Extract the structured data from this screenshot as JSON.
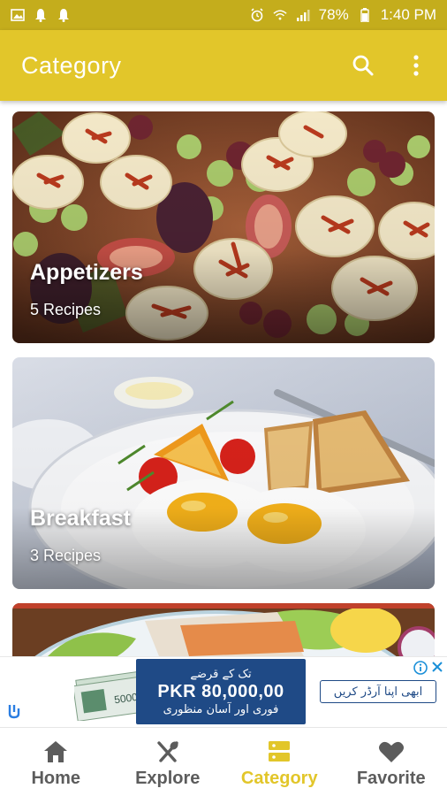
{
  "status_bar": {
    "battery": "78%",
    "time": "1:40 PM",
    "left_icons": [
      "gallery-icon",
      "bell-icon",
      "bell-icon"
    ],
    "right_icons": [
      "alarm-icon",
      "wifi-icon",
      "signal-icon",
      "battery-icon"
    ]
  },
  "app_bar": {
    "title": "Category",
    "actions": [
      "search-icon",
      "more-vert-icon"
    ],
    "color": "#e2c62a"
  },
  "categories": [
    {
      "name": "Appetizers",
      "count": "5 Recipes"
    },
    {
      "name": "Breakfast",
      "count": "3 Recipes"
    },
    {
      "name": "",
      "count": ""
    }
  ],
  "ad": {
    "urdu_top": "تک کے قرضے",
    "amount": "PKR 80,000,00",
    "urdu_bottom": "فوری اور آسان منظوری",
    "cta": "ابھی اپنا آرڈر کریں",
    "panel_color": "#1f4a86"
  },
  "bottom_nav": {
    "items": [
      {
        "label": "Home",
        "icon": "home-icon"
      },
      {
        "label": "Explore",
        "icon": "utensils-icon"
      },
      {
        "label": "Category",
        "icon": "category-icon",
        "active": true
      },
      {
        "label": "Favorite",
        "icon": "heart-icon"
      }
    ],
    "active_color": "#e2c62a",
    "inactive_color": "#5c5c5c"
  }
}
